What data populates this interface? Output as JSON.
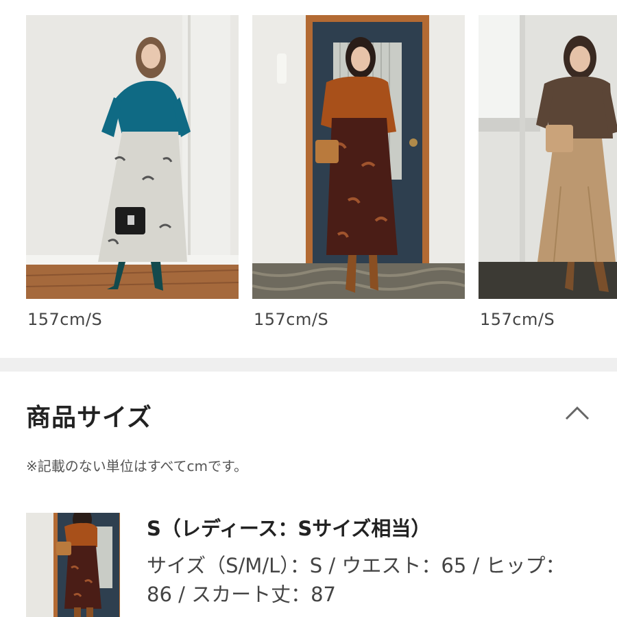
{
  "gallery": {
    "items": [
      {
        "caption": "157cm/S"
      },
      {
        "caption": "157cm/S"
      },
      {
        "caption": "157cm/S"
      }
    ]
  },
  "size_section": {
    "title": "商品サイズ",
    "note": "※記載のない単位はすべてcmです。",
    "collapse_icon": "chevron-up-icon",
    "entries": [
      {
        "title": "S（レディース：Sサイズ相当）",
        "detail": "サイズ（S/M/L）：S / ウエスト：65 / ヒップ：86 / スカート丈：87"
      }
    ]
  },
  "colors": {
    "divider": "#efefef",
    "title_text": "#222222",
    "body_text": "#444444"
  }
}
